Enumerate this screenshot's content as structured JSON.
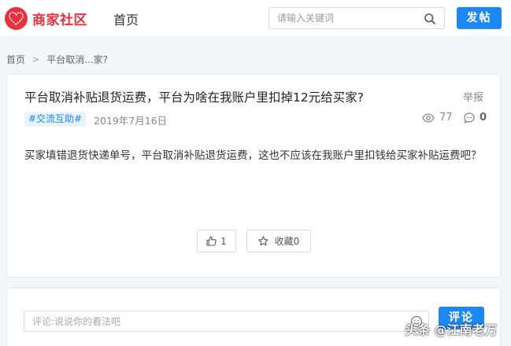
{
  "header": {
    "brand": "商家社区",
    "nav_home": "首页",
    "search_placeholder": "请输入关键词",
    "post_button": "发帖",
    "brand_color": "#e8313d",
    "accent_color": "#1e88f2"
  },
  "breadcrumb": {
    "home": "首页",
    "separator": ">",
    "current": "平台取消...家?"
  },
  "post": {
    "title": "平台取消补贴退货运费，平台为啥在我账户里扣掉12元给买家?",
    "report": "举报",
    "tag": "#交流互助#",
    "date": "2019年7月16日",
    "views": "77",
    "comments": "0",
    "content": "买家填错退货快递单号，平台取消补贴退货运费，这也不应该在我账户里扣钱给买家补贴运费吧？",
    "like_count": "1",
    "favorite_label": "收藏0"
  },
  "comment": {
    "placeholder": "评论:说说你的看法吧",
    "submit": "评论"
  },
  "watermark": "头条 @江南老万"
}
